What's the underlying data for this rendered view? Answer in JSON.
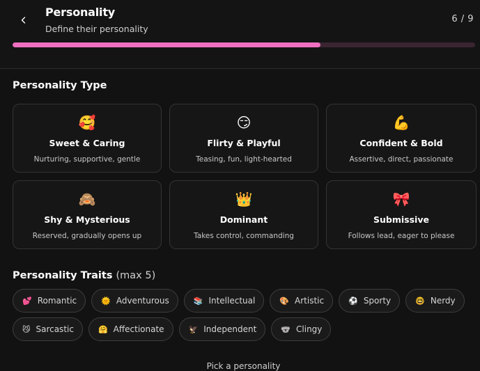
{
  "header": {
    "title": "Personality",
    "subtitle": "Define their personality",
    "step": "6 / 9",
    "progress": 0.666,
    "colors": {
      "accent": "#f06fc0",
      "track": "#3b2432"
    }
  },
  "personality_type": {
    "title": "Personality Type",
    "options": [
      {
        "icon": "smiling-face-with-hearts-icon",
        "emoji": "🥰",
        "name": "Sweet & Caring",
        "desc": "Nurturing, supportive, gentle"
      },
      {
        "icon": "smirk-face-icon",
        "emoji": "😏",
        "name": "Flirty & Playful",
        "desc": "Teasing, fun, light-hearted"
      },
      {
        "icon": "flexed-biceps-icon",
        "emoji": "💪",
        "name": "Confident & Bold",
        "desc": "Assertive, direct, passionate"
      },
      {
        "icon": "see-no-evil-monkey-icon",
        "emoji": "🙈",
        "name": "Shy & Mysterious",
        "desc": "Reserved, gradually opens up"
      },
      {
        "icon": "crown-icon",
        "emoji": "👑",
        "name": "Dominant",
        "desc": "Takes control, commanding"
      },
      {
        "icon": "ribbon-icon",
        "emoji": "🎀",
        "name": "Submissive",
        "desc": "Follows lead, eager to please"
      }
    ]
  },
  "traits": {
    "title": "Personality Traits",
    "note": "(max 5)",
    "items": [
      {
        "icon": "heart-icon",
        "emoji": "💕",
        "label": "Romantic"
      },
      {
        "icon": "sun-icon",
        "emoji": "🌞",
        "label": "Adventurous"
      },
      {
        "icon": "books-icon",
        "emoji": "📚",
        "label": "Intellectual"
      },
      {
        "icon": "palette-icon",
        "emoji": "🎨",
        "label": "Artistic"
      },
      {
        "icon": "ball-icon",
        "emoji": "⚽",
        "label": "Sporty"
      },
      {
        "icon": "nerd-face-icon",
        "emoji": "🤓",
        "label": "Nerdy"
      },
      {
        "icon": "smirk-cat-icon",
        "emoji": "😼",
        "label": "Sarcastic"
      },
      {
        "icon": "hugging-face-icon",
        "emoji": "🤗",
        "label": "Affectionate"
      },
      {
        "icon": "eagle-icon",
        "emoji": "🦅",
        "label": "Independent"
      },
      {
        "icon": "koala-icon",
        "emoji": "🐨",
        "label": "Clingy"
      }
    ]
  },
  "footer": {
    "text": "Pick a personality"
  }
}
